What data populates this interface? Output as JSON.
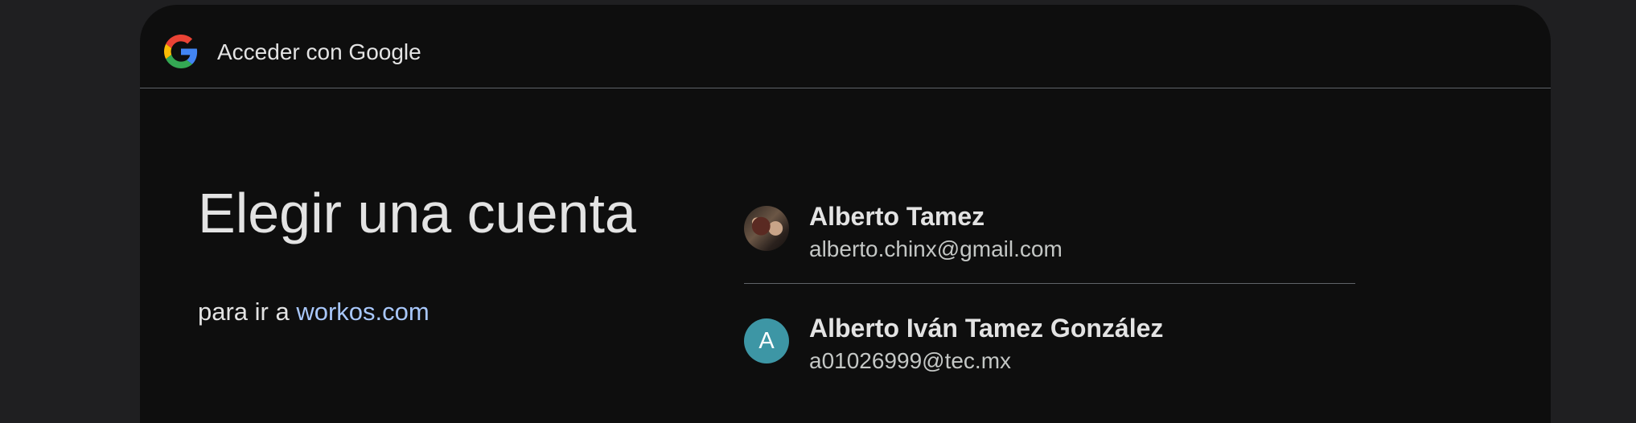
{
  "header": {
    "title": "Acceder con Google",
    "logo_icon": "google-g-icon"
  },
  "main": {
    "heading": "Elegir una cuenta",
    "subtitle_prefix": "para ir a",
    "subtitle_link": "workos.com"
  },
  "accounts": [
    {
      "name": "Alberto Tamez",
      "email": "alberto.chinx@gmail.com",
      "avatar": "photo-avatar"
    },
    {
      "name": "Alberto Iván Tamez González",
      "email": "a01026999@tec.mx",
      "avatar_letter": "A",
      "avatar_color": "#3d96a5"
    }
  ],
  "colors": {
    "page_bg": "#1f1f21",
    "card_bg": "#0e0e0e",
    "text": "#e3e3e3",
    "link": "#a8c7fa",
    "divider": "#5f6368"
  }
}
